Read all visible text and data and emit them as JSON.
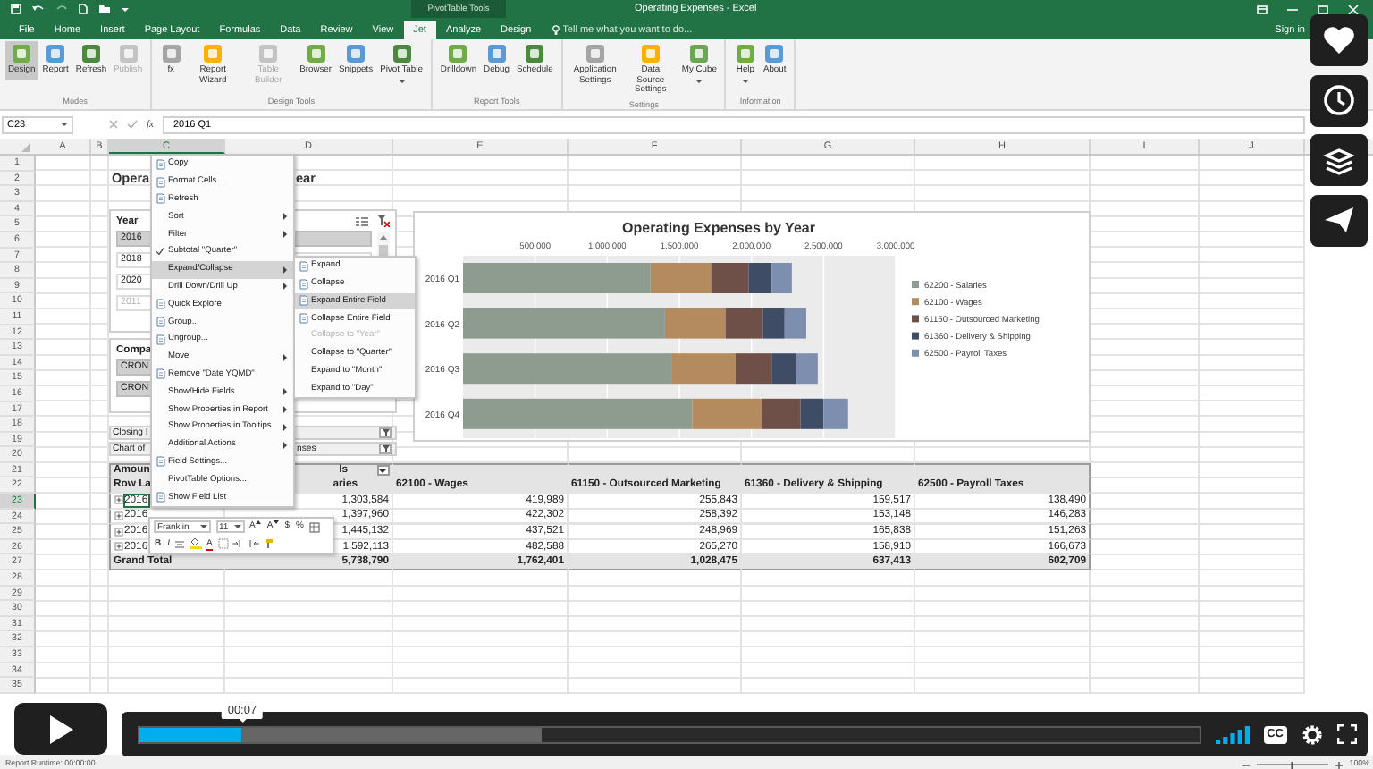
{
  "window": {
    "title": "Operating Expenses - Excel",
    "context_tab": "PivotTable Tools"
  },
  "tabs": [
    {
      "label": "File",
      "selected": false
    },
    {
      "label": "Home",
      "selected": false
    },
    {
      "label": "Insert",
      "selected": false
    },
    {
      "label": "Page Layout",
      "selected": false
    },
    {
      "label": "Formulas",
      "selected": false
    },
    {
      "label": "Data",
      "selected": false
    },
    {
      "label": "Review",
      "selected": false
    },
    {
      "label": "View",
      "selected": false
    },
    {
      "label": "Jet",
      "selected": true
    },
    {
      "label": "Analyze",
      "selected": false
    },
    {
      "label": "Design",
      "selected": false
    }
  ],
  "tell_me": {
    "placeholder": "Tell me what you want to do..."
  },
  "sign_in": "Sign in",
  "ribbon": [
    {
      "label": "Modes",
      "buttons": [
        {
          "label": "Design",
          "selected": true,
          "disabled": false,
          "dropdown": false
        },
        {
          "label": "Report",
          "selected": false,
          "disabled": false,
          "dropdown": false
        },
        {
          "label": "Refresh",
          "selected": false,
          "disabled": false,
          "dropdown": false
        },
        {
          "label": "Publish",
          "selected": false,
          "disabled": true,
          "dropdown": false
        }
      ]
    },
    {
      "label": "Design Tools",
      "buttons": [
        {
          "label": "fx",
          "selected": false,
          "disabled": false,
          "dropdown": false
        },
        {
          "label": "Report Wizard",
          "selected": false,
          "disabled": false,
          "dropdown": false
        },
        {
          "label": "Table Builder",
          "selected": false,
          "disabled": true,
          "dropdown": false
        },
        {
          "label": "Browser",
          "selected": false,
          "disabled": false,
          "dropdown": false
        },
        {
          "label": "Snippets",
          "selected": false,
          "disabled": false,
          "dropdown": false
        },
        {
          "label": "Pivot Table",
          "selected": false,
          "disabled": false,
          "dropdown": true
        }
      ]
    },
    {
      "label": "Report Tools",
      "buttons": [
        {
          "label": "Drilldown",
          "selected": false,
          "disabled": false,
          "dropdown": false
        },
        {
          "label": "Debug",
          "selected": false,
          "disabled": false,
          "dropdown": false
        },
        {
          "label": "Schedule",
          "selected": false,
          "disabled": false,
          "dropdown": false
        }
      ]
    },
    {
      "label": "Settings",
      "buttons": [
        {
          "label": "Application Settings",
          "selected": false,
          "disabled": false,
          "dropdown": false
        },
        {
          "label": "Data Source Settings",
          "selected": false,
          "disabled": false,
          "dropdown": false
        },
        {
          "label": "My Cube",
          "selected": false,
          "disabled": false,
          "dropdown": true
        }
      ]
    },
    {
      "label": "Information",
      "buttons": [
        {
          "label": "Help",
          "selected": false,
          "disabled": false,
          "dropdown": true
        },
        {
          "label": "About",
          "selected": false,
          "disabled": false,
          "dropdown": false
        }
      ]
    }
  ],
  "formula_bar": {
    "name_box": "C23",
    "function_label": "fx",
    "value": "2016 Q1"
  },
  "columns": [
    {
      "label": "A",
      "selected": false
    },
    {
      "label": "B",
      "selected": false
    },
    {
      "label": "C",
      "selected": true
    },
    {
      "label": "D",
      "selected": false
    },
    {
      "label": "E",
      "selected": false
    },
    {
      "label": "F",
      "selected": false
    },
    {
      "label": "G",
      "selected": false
    },
    {
      "label": "H",
      "selected": false
    },
    {
      "label": "I",
      "selected": false
    },
    {
      "label": "J",
      "selected": false
    }
  ],
  "rows": [
    {
      "label": "1",
      "selected": false
    },
    {
      "label": "2",
      "selected": false
    },
    {
      "label": "3",
      "selected": false
    },
    {
      "label": "4",
      "selected": false
    },
    {
      "label": "5",
      "selected": false
    },
    {
      "label": "6",
      "selected": false
    },
    {
      "label": "7",
      "selected": false
    },
    {
      "label": "8",
      "selected": false
    },
    {
      "label": "9",
      "selected": false
    },
    {
      "label": "10",
      "selected": false
    },
    {
      "label": "11",
      "selected": false
    },
    {
      "label": "12",
      "selected": false
    },
    {
      "label": "13",
      "selected": false
    },
    {
      "label": "14",
      "selected": false
    },
    {
      "label": "15",
      "selected": false
    },
    {
      "label": "16",
      "selected": false
    },
    {
      "label": "17",
      "selected": false
    },
    {
      "label": "18",
      "selected": false
    },
    {
      "label": "19",
      "selected": false
    },
    {
      "label": "20",
      "selected": false
    },
    {
      "label": "21",
      "selected": false
    },
    {
      "label": "22",
      "selected": false
    },
    {
      "label": "23",
      "selected": true
    },
    {
      "label": "24",
      "selected": false
    },
    {
      "label": "25",
      "selected": false
    },
    {
      "label": "26",
      "selected": false
    },
    {
      "label": "27",
      "selected": false
    },
    {
      "label": "28",
      "selected": false
    },
    {
      "label": "29",
      "selected": false
    },
    {
      "label": "30",
      "selected": false
    },
    {
      "label": "31",
      "selected": false
    },
    {
      "label": "32",
      "selected": false
    },
    {
      "label": "33",
      "selected": false
    },
    {
      "label": "34",
      "selected": false
    },
    {
      "label": "35",
      "selected": false
    }
  ],
  "title_parts": [
    "Opera",
    "ear"
  ],
  "year_slicer": {
    "title": "Year",
    "items": [
      {
        "label": "2016",
        "selected": true,
        "disabled": false
      },
      {
        "label": "2018",
        "selected": false,
        "disabled": false
      },
      {
        "label": "2020",
        "selected": false,
        "disabled": false
      },
      {
        "label": "2011",
        "selected": false,
        "disabled": true
      }
    ]
  },
  "company_slicer": {
    "title": "Compa",
    "items": [
      {
        "label": "CRON",
        "selected": true,
        "disabled": false
      },
      {
        "label": "CRON",
        "selected": true,
        "disabled": false
      }
    ]
  },
  "filters": [
    {
      "label": "Closing I"
    },
    {
      "label": "Chart of",
      "value": "nses"
    }
  ],
  "chart": {
    "chart_data": {
      "type": "bar",
      "orientation": "horizontal",
      "stacked": true,
      "grid": true,
      "legend": "right",
      "title": "Operating Expenses by Year",
      "categories": [
        "2016 Q1",
        "2016 Q2",
        "2016 Q3",
        "2016 Q4"
      ],
      "xlim": [
        0,
        3000000
      ],
      "xticks": [
        {
          "value": 500000,
          "label": "500,000"
        },
        {
          "value": 1000000,
          "label": "1,000,000"
        },
        {
          "value": 1500000,
          "label": "1,500,000"
        },
        {
          "value": 2000000,
          "label": "2,000,000"
        },
        {
          "value": 2500000,
          "label": "2,500,000"
        },
        {
          "value": 3000000,
          "label": "3,000,000"
        }
      ],
      "series": [
        {
          "name": "62200 - Salaries",
          "color": "#8e9c90",
          "values": [
            1300000,
            1400000,
            1450000,
            1590000
          ]
        },
        {
          "name": "62100 - Wages",
          "color": "#b48b5e",
          "values": [
            420000,
            420000,
            440000,
            480000
          ]
        },
        {
          "name": "61150 - Outsourced Marketing",
          "color": "#6e5048",
          "values": [
            260000,
            260000,
            250000,
            270000
          ]
        },
        {
          "name": "61360 - Delivery & Shipping",
          "color": "#3e4c66",
          "values": [
            160000,
            150000,
            170000,
            160000
          ]
        },
        {
          "name": "62500 - Payroll Taxes",
          "color": "#7e8eae",
          "values": [
            140000,
            150000,
            150000,
            170000
          ]
        }
      ]
    }
  },
  "pivot": {
    "corner": "Amoun",
    "column_labels": "ls",
    "headers": [
      "Row La",
      "aries",
      "62100 - Wages",
      "61150 - Outsourced Marketing",
      "61360 - Delivery & Shipping",
      "62500 - Payroll Taxes"
    ],
    "rows": [
      {
        "label": "2016",
        "selected": true,
        "values": [
          "1,303,584",
          "419,989",
          "255,843",
          "159,517",
          "138,490"
        ]
      },
      {
        "label": "2016",
        "selected": false,
        "values": [
          "1,397,960",
          "422,302",
          "258,392",
          "153,148",
          "146,283"
        ]
      },
      {
        "label": "2016",
        "selected": false,
        "values": [
          "1,445,132",
          "437,521",
          "248,969",
          "165,838",
          "151,263"
        ]
      },
      {
        "label": "2016",
        "selected": false,
        "values": [
          "1,592,113",
          "482,588",
          "265,270",
          "158,910",
          "166,673"
        ]
      }
    ],
    "total": {
      "label": "Grand Total",
      "values": [
        "5,738,790",
        "1,762,401",
        "1,028,475",
        "637,413",
        "602,709"
      ]
    }
  },
  "context_menu": {
    "items": [
      {
        "label": "Copy",
        "icon": true,
        "submenu": false,
        "checked": false,
        "selected": false,
        "disabled": false
      },
      {
        "label": "Format Cells...",
        "icon": true,
        "submenu": false,
        "checked": false,
        "selected": false,
        "disabled": false
      },
      {
        "label": "Refresh",
        "icon": true,
        "submenu": false,
        "checked": false,
        "selected": false,
        "disabled": false
      },
      {
        "label": "Sort",
        "icon": false,
        "submenu": true,
        "checked": false,
        "selected": false,
        "disabled": false
      },
      {
        "label": "Filter",
        "icon": false,
        "submenu": true,
        "checked": false,
        "selected": false,
        "disabled": false
      },
      {
        "label": "Subtotal \"Quarter\"",
        "icon": false,
        "submenu": false,
        "checked": true,
        "selected": false,
        "disabled": false
      },
      {
        "label": "Expand/Collapse",
        "icon": false,
        "submenu": true,
        "checked": false,
        "selected": true,
        "disabled": false
      },
      {
        "label": "Drill Down/Drill Up",
        "icon": false,
        "submenu": true,
        "checked": false,
        "selected": false,
        "disabled": false
      },
      {
        "label": "Quick Explore",
        "icon": true,
        "submenu": false,
        "checked": false,
        "selected": false,
        "disabled": false
      },
      {
        "label": "Group...",
        "icon": true,
        "submenu": false,
        "checked": false,
        "selected": false,
        "disabled": false
      },
      {
        "label": "Ungroup...",
        "icon": true,
        "submenu": false,
        "checked": false,
        "selected": false,
        "disabled": false
      },
      {
        "label": "Move",
        "icon": false,
        "submenu": true,
        "checked": false,
        "selected": false,
        "disabled": false
      },
      {
        "label": "Remove \"Date YQMD\"",
        "icon": true,
        "submenu": false,
        "checked": false,
        "selected": false,
        "disabled": false
      },
      {
        "label": "Show/Hide Fields",
        "icon": false,
        "submenu": true,
        "checked": false,
        "selected": false,
        "disabled": false
      },
      {
        "label": "Show Properties in Report",
        "icon": false,
        "submenu": true,
        "checked": false,
        "selected": false,
        "disabled": false
      },
      {
        "label": "Show Properties in Tooltips",
        "icon": false,
        "submenu": true,
        "checked": false,
        "selected": false,
        "disabled": false
      },
      {
        "label": "Additional Actions",
        "icon": false,
        "submenu": true,
        "checked": false,
        "selected": false,
        "disabled": false
      },
      {
        "label": "Field Settings...",
        "icon": true,
        "submenu": false,
        "checked": false,
        "selected": false,
        "disabled": false
      },
      {
        "label": "PivotTable Options...",
        "icon": false,
        "submenu": false,
        "checked": false,
        "selected": false,
        "disabled": false
      },
      {
        "label": "Show Field List",
        "icon": true,
        "submenu": false,
        "checked": false,
        "selected": false,
        "disabled": false
      }
    ]
  },
  "submenu": {
    "items": [
      {
        "label": "Expand",
        "icon": true,
        "selected": false,
        "disabled": false
      },
      {
        "label": "Collapse",
        "icon": true,
        "selected": false,
        "disabled": false
      },
      {
        "label": "Expand Entire Field",
        "icon": true,
        "selected": true,
        "disabled": false
      },
      {
        "label": "Collapse Entire Field",
        "icon": true,
        "selected": false,
        "disabled": false
      },
      {
        "label": "Collapse to \"Year\"",
        "icon": false,
        "selected": false,
        "disabled": true
      },
      {
        "label": "Collapse to \"Quarter\"",
        "icon": false,
        "selected": false,
        "disabled": false
      },
      {
        "label": "Expand to \"Month\"",
        "icon": false,
        "selected": false,
        "disabled": false
      },
      {
        "label": "Expand to \"Day\"",
        "icon": false,
        "selected": false,
        "disabled": false
      }
    ]
  },
  "mini_toolbar": {
    "font": "Franklin",
    "size": "11",
    "top_buttons": [
      "A",
      "A",
      "$",
      "%"
    ],
    "bottom_buttons": [
      "B",
      "I",
      "A"
    ]
  },
  "status_bar": {
    "text": "Report Runtime: 00:00:00",
    "zoom_slider": {
      "level": 0.5
    },
    "zoom": "100%"
  },
  "player": {
    "time": "00:07",
    "cc": "CC",
    "progress": {
      "level": 0.097
    },
    "buffer": {
      "level": 0.38
    }
  }
}
